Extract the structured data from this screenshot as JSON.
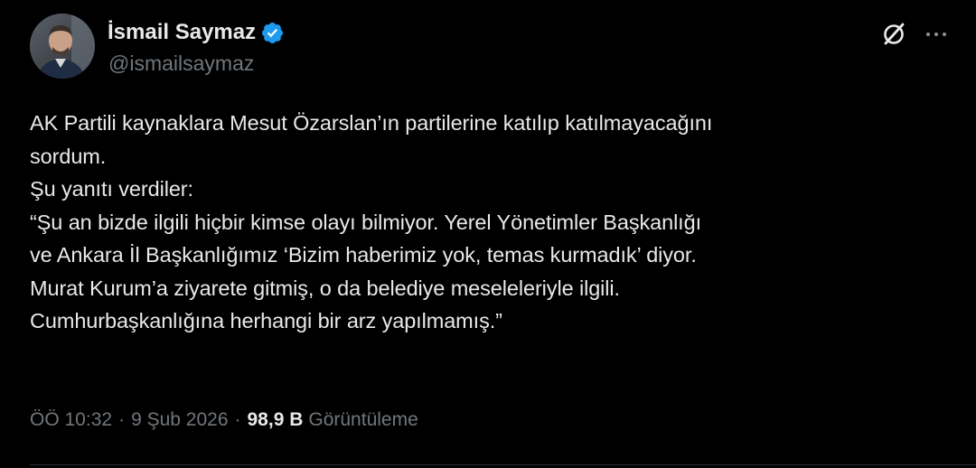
{
  "author": {
    "display_name": "İsmail Saymaz",
    "handle": "@ismailsaymaz",
    "verified": true
  },
  "tweet": {
    "lines": [
      "AK Partili kaynaklara Mesut Özarslan’ın partilerine katılıp katılmayacağını",
      "sordum.",
      "Şu yanıtı verdiler:",
      "“Şu an bizde ilgili hiçbir kimse olayı bilmiyor. Yerel Yönetimler Başkanlığı",
      "ve Ankara İl Başkanlığımız ‘Bizim haberimiz yok, temas kurmadık’ diyor.",
      "Murat Kurum’a ziyarete gitmiş, o da belediye meseleleriyle ilgili.",
      "Cumhurbaşkanlığına herhangi bir arz yapılmamış.”"
    ]
  },
  "meta": {
    "time": "ÖÖ 10:32",
    "separator": "·",
    "date": "9 Şub 2026",
    "views_count": "98,9 B",
    "views_label": "Görüntüleme"
  },
  "icons": {
    "verified": "verified-badge-icon",
    "grok": "grok-icon",
    "more": "more-options-icon"
  },
  "colors": {
    "background": "#000000",
    "text_primary": "#e7e9ea",
    "text_secondary": "#71767b",
    "verified_blue": "#1d9bf0",
    "divider": "#2f3336"
  }
}
